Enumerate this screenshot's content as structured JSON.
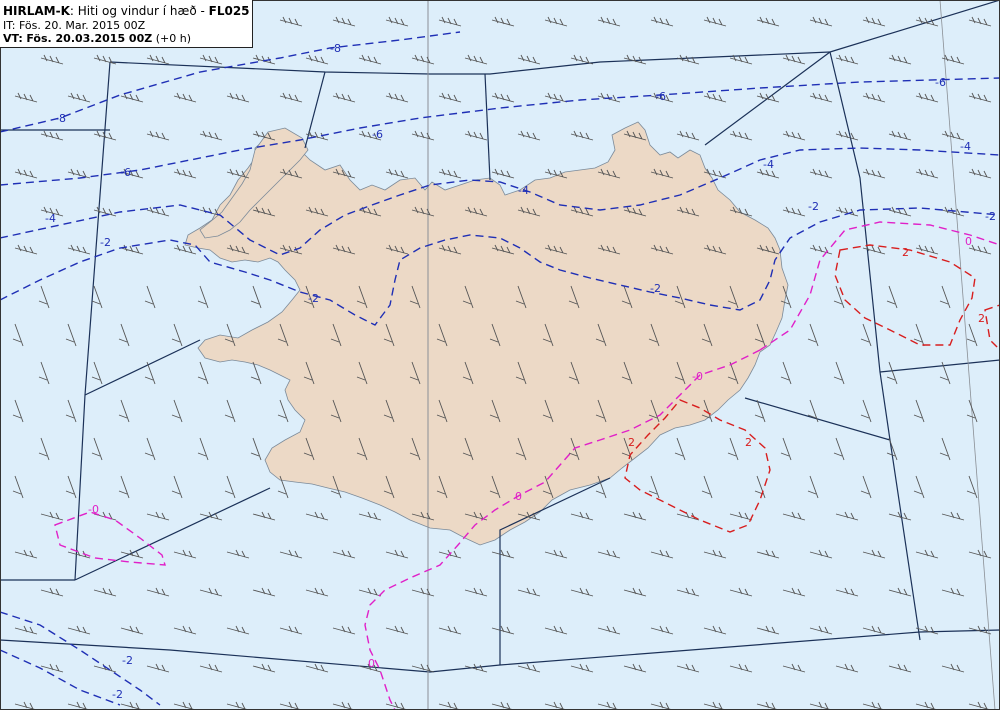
{
  "header": {
    "model": "HIRLAM-K",
    "separator": ":",
    "description": "Hiti og vindur í hæð -",
    "level": "FL025",
    "init_label": "IT:",
    "init_time": "Fös. 20. Mar. 2015 00Z",
    "valid_label": "VT:",
    "valid_time": "Fös. 20.03.2015 00Z",
    "lead": "(+0 h)"
  },
  "colors": {
    "sea": "#ddeefa",
    "land": "#ecd9c6",
    "negative_isotherm": "#1f2fb5",
    "zero_isotherm": "#e020c8",
    "positive_isotherm": "#d81e1e",
    "borders": "#1b3158",
    "wind_barb": "#555555"
  },
  "contour_labels": [
    {
      "text": "-8",
      "color": "negative_isotherm"
    },
    {
      "text": "-8",
      "color": "negative_isotherm"
    },
    {
      "text": "-6",
      "color": "negative_isotherm"
    },
    {
      "text": "-6",
      "color": "negative_isotherm"
    },
    {
      "text": "-6",
      "color": "negative_isotherm"
    },
    {
      "text": "-6",
      "color": "negative_isotherm"
    },
    {
      "text": "-4",
      "color": "negative_isotherm"
    },
    {
      "text": "-4",
      "color": "negative_isotherm"
    },
    {
      "text": "-4",
      "color": "negative_isotherm"
    },
    {
      "text": "-4",
      "color": "negative_isotherm"
    },
    {
      "text": "-2",
      "color": "negative_isotherm"
    },
    {
      "text": "-2",
      "color": "negative_isotherm"
    },
    {
      "text": "-2",
      "color": "negative_isotherm"
    },
    {
      "text": "-2",
      "color": "negative_isotherm"
    },
    {
      "text": "-2",
      "color": "negative_isotherm"
    },
    {
      "text": "-2",
      "color": "negative_isotherm"
    },
    {
      "text": "-2",
      "color": "negative_isotherm"
    },
    {
      "text": "0",
      "color": "zero_isotherm"
    },
    {
      "text": "0",
      "color": "zero_isotherm"
    },
    {
      "text": "0",
      "color": "zero_isotherm"
    },
    {
      "text": "-0",
      "color": "zero_isotherm"
    },
    {
      "text": "-0",
      "color": "zero_isotherm"
    },
    {
      "text": "2",
      "color": "positive_isotherm"
    },
    {
      "text": "2",
      "color": "positive_isotherm"
    },
    {
      "text": "2",
      "color": "positive_isotherm"
    },
    {
      "text": "2",
      "color": "positive_isotherm"
    }
  ]
}
